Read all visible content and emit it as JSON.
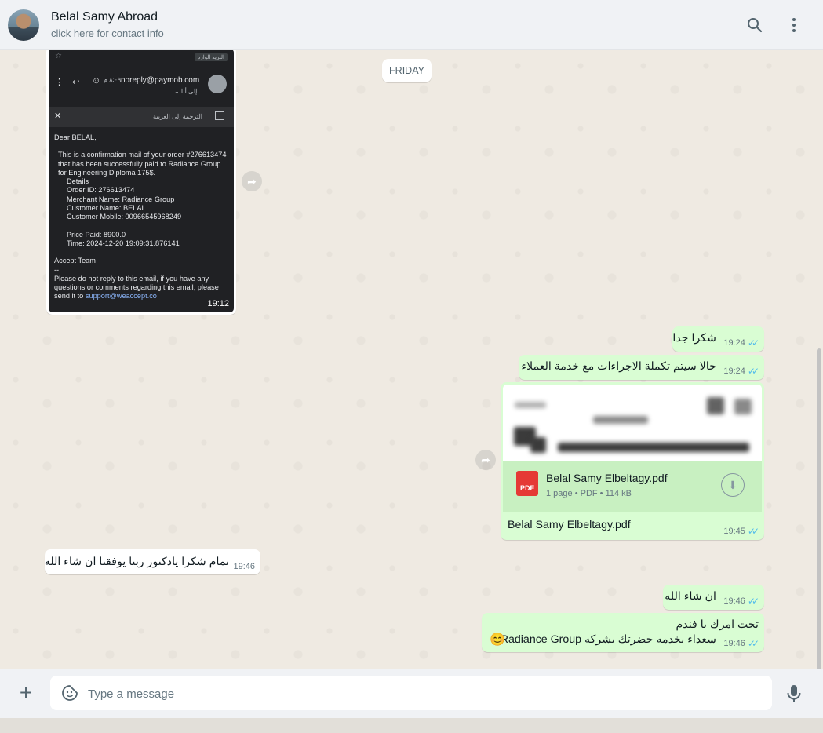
{
  "header": {
    "contact_name": "Belal Samy Abroad",
    "contact_sub": "click here for contact info",
    "icons": [
      "search-icon",
      "menu-icon"
    ]
  },
  "chat": {
    "date_chip": "FRIDAY",
    "image_message": {
      "time": "19:12",
      "email": {
        "tag": "البريد الوارد",
        "from": "noreply@paymob.com",
        "from_time": "٨:٠٩ م",
        "to": "إلى أنا ⌄",
        "translate": "الترجمة إلى العربية",
        "greeting": "Dear BELAL,",
        "body": "This is a confirmation mail of your order #276613474 that has been successfully paid to Radiance Group for Engineering Diploma 175$.",
        "details_label": "Details",
        "order_id": "Order ID: 276613474",
        "merchant": "Merchant Name: Radiance Group",
        "customer_name": "Customer Name: BELAL",
        "customer_mobile": "Customer Mobile: 00966545968249",
        "price": "Price Paid: 8900.0",
        "time_line": "Time: 2024-12-20 19:09:31.876141",
        "team": "Accept Team",
        "dashes": "--",
        "footer": "Please do not reply to this email, if you have any questions or comments regarding this email, please send it to",
        "support": "support@weaccept.co"
      }
    },
    "messages": [
      {
        "text": "شكرا جدا",
        "time": "19:24"
      },
      {
        "text": "حالا سيتم تكملة الاجراءات مع خدمة العملاء",
        "time": "19:24"
      },
      {
        "text": "تمام شكرا يادكتور ربنا يوفقنا ان شاء الله",
        "time": "19:46"
      },
      {
        "text": "ان شاء الله",
        "time": "19:46"
      },
      {
        "line1": "تحت امرك يا فندم",
        "line2": "سعداء بخدمه حضرتك بشركه Radiance Group",
        "emoji": "😊",
        "time": "19:46"
      }
    ],
    "pdf": {
      "name": "Belal Samy Elbeltagy.pdf",
      "meta": "1 page • PDF • 114 kB",
      "badge": "PDF",
      "caption": "Belal Samy Elbeltagy.pdf",
      "time": "19:45"
    }
  },
  "footer": {
    "placeholder": "Type a message"
  },
  "colors": {
    "outgoing": "#d9fdd3",
    "incoming": "#ffffff",
    "ticks": "#53bdeb",
    "wallpaper": "#efeae2"
  }
}
